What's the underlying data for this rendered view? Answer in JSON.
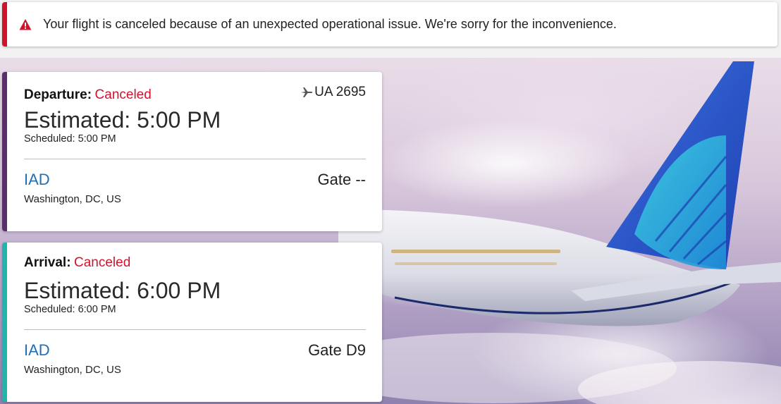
{
  "alert": {
    "icon": "warning-triangle-icon",
    "color": "#d0142c",
    "message": "Your flight is canceled because of an unexpected operational issue. We're sorry for the inconvenience."
  },
  "departure": {
    "label": "Departure:",
    "status": "Canceled",
    "flight_number": "UA 2695",
    "flight_icon": "airplane-icon",
    "estimated": "Estimated: 5:00 PM",
    "scheduled": "Scheduled: 5:00 PM",
    "airport_code": "IAD",
    "gate": "Gate --",
    "city": "Washington, DC, US",
    "accent": "#5b2d6e"
  },
  "arrival": {
    "label": "Arrival:",
    "status": "Canceled",
    "estimated": "Estimated: 6:00 PM",
    "scheduled": "Scheduled: 6:00 PM",
    "airport_code": "IAD",
    "gate": "Gate D9",
    "city": "Washington, DC, US",
    "accent": "#1fb5ad"
  },
  "colors": {
    "canceled": "#d0142c",
    "link": "#1f6fb5"
  }
}
